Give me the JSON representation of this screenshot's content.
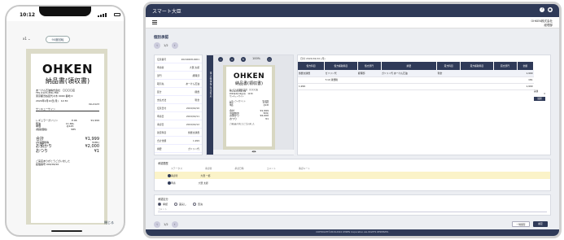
{
  "phone": {
    "time": "10:12",
    "page_select": "x1  ⌄",
    "rotate_button": "90度回転",
    "close_label": "閉じる"
  },
  "receipt": {
    "logo": "OHKEN",
    "title": "納品書(領収書)",
    "shop_lines": [
      "あーけん石油株式会社　〇〇〇〇店",
      "TEL 0123-456-789",
      "東京都渋谷区代々木 0000 番地 0"
    ],
    "date_line": "2024年2月10日(月)　12:30",
    "doc_no": "No.0123",
    "vehicle": "サンキューサイン",
    "items_header": [
      "品名",
      "数量",
      "単価",
      "金額"
    ],
    "items": [
      {
        "name": "レギュラーガソリン",
        "qty": "P-06",
        "amount": "¥1,999"
      },
      {
        "name": "軽油",
        "qty": "11.66L",
        "amount": ""
      },
      {
        "name": "単価",
        "qty": "@145",
        "amount": ""
      },
      {
        "name": "(税抜価格)",
        "qty": "¥85",
        "amount": ""
      }
    ],
    "total_label": "合計",
    "total_value": "¥1,999",
    "tax_label": "(内消費税等",
    "tax_value": "¥181)",
    "paid_label": "お預かり",
    "paid_value": "¥2,000",
    "change_label": "おつり",
    "change_value": "¥1",
    "footer_lines": [
      "ご来店ありがとうございました",
      "処理番号 000/00/10"
    ]
  },
  "laptop": {
    "app_title": "スマート大臣",
    "company": "OHKEN株式会社",
    "company_sub": "経理部",
    "page_title": "個別承認",
    "page_no": "1/2",
    "fields": [
      {
        "label": "伝票番号",
        "value": "20240208-0001"
      },
      {
        "label": "申請者",
        "value": "大賢 太郎"
      },
      {
        "label": "部門",
        "value": "経理部"
      },
      {
        "label": "取引先",
        "value": "あーけん石油"
      },
      {
        "label": "区分",
        "value": "経費"
      },
      {
        "label": "支払方法",
        "value": "現金"
      },
      {
        "label": "伝票日付",
        "value": "2024/02/10"
      },
      {
        "label": "申請日",
        "value": "2024/02/11"
      },
      {
        "label": "承認日",
        "value": "2024/02/12"
      },
      {
        "label": "勘定科目",
        "value": "旅費交通費"
      },
      {
        "label": "合計金額",
        "value": "1,999"
      },
      {
        "label": "摘要",
        "value": "ガソリン代"
      }
    ],
    "viewer_strip_text": "電子帳簿保存法対応",
    "viewer_zoom": "100%",
    "table_header_info": "日付 2024/02/10 (月)",
    "table_columns": [
      "借方科目",
      "借方補助科目",
      "借方部門",
      "摘要",
      "貸方科目",
      "貸方補助科目",
      "貸方部門",
      "金額"
    ],
    "table_rows": [
      [
        "旅費交通費",
        "ガソリン代",
        "経理部",
        "ガソリン代 あーけん石油",
        "現金",
        "",
        "",
        "1,999"
      ],
      [
        "",
        "T-10 消費税",
        "",
        "",
        "",
        "",
        "",
        "181"
      ],
      [
        "1,999",
        "",
        "",
        "",
        "",
        "",
        "",
        "1,999"
      ]
    ],
    "side_labels": [
      "差額",
      "0"
    ],
    "side_button": "展開",
    "history_title": "承認履歴",
    "history_cols": [
      "ステータス",
      "承認者",
      "承認日時",
      "コメント",
      "承認ルート"
    ],
    "history_rows": [
      {
        "status": "承認待",
        "user": "大賢 一郎"
      },
      {
        "status": "申請",
        "user": "大賢 太郎"
      }
    ],
    "approval_title": "承認区分",
    "approval_options": [
      "承認",
      "差戻し",
      "否決"
    ],
    "comment_placeholder": "コメント",
    "prev_next": "1/2",
    "btn_save": "一時保存",
    "btn_submit": "確定",
    "footer": "COPYRIGHT©2018-2024 OHKEN Corporation ALL RIGHTS RESERVED."
  }
}
